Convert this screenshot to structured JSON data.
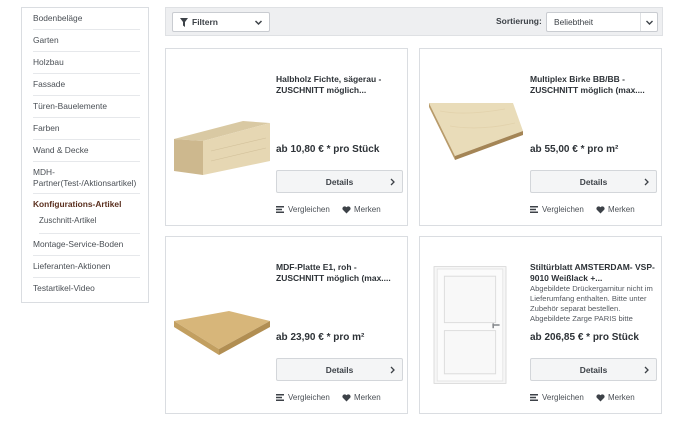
{
  "sidebar": {
    "items": [
      {
        "label": "Bodenbeläge"
      },
      {
        "label": "Garten"
      },
      {
        "label": "Holzbau"
      },
      {
        "label": "Fassade"
      },
      {
        "label": "Türen-Bauelemente"
      },
      {
        "label": "Farben"
      },
      {
        "label": "Wand & Decke"
      },
      {
        "label": "MDH-Partner(Test-/Aktionsartikel)"
      },
      {
        "label": "Konfigurations-Artikel"
      },
      {
        "label": "Zuschnitt-Artikel"
      },
      {
        "label": "Montage-Service-Boden"
      },
      {
        "label": "Lieferanten-Aktionen"
      },
      {
        "label": "Testartikel-Video"
      }
    ]
  },
  "filterbar": {
    "filter_label": "Filtern",
    "sort_label": "Sortierung:",
    "sort_value": "Beliebtheit"
  },
  "products": [
    {
      "title": "Halbholz Fichte, sägerau - ZUSCHNITT möglich...",
      "description": "",
      "price": "ab 10,80 € * pro Stück",
      "details_label": "Details",
      "compare_label": "Vergleichen",
      "note_label": "Merken"
    },
    {
      "title": "Multiplex Birke BB/BB - ZUSCHNITT möglich (max....",
      "description": "",
      "price": "ab 55,00 € * pro m²",
      "details_label": "Details",
      "compare_label": "Vergleichen",
      "note_label": "Merken"
    },
    {
      "title": "MDF-Platte E1, roh - ZUSCHNITT möglich (max....",
      "description": "",
      "price": "ab 23,90 € * pro m²",
      "details_label": "Details",
      "compare_label": "Vergleichen",
      "note_label": "Merken"
    },
    {
      "title": "Stiltürblatt AMSTERDAM- VSP-9010 Weißlack +...",
      "description": "Abgebildete Drückergarnitur nicht im Lieferumfang enthalten. Bitte unter Zubehör separat bestellen. Abgebildete Zarge PARIS bitte",
      "price": "ab 206,85 € * pro Stück",
      "details_label": "Details",
      "compare_label": "Vergleichen",
      "note_label": "Merken"
    }
  ],
  "colors": {
    "active_category": "#5a2f1e",
    "border": "#dadde1",
    "filterbar_bg": "#eeeff1"
  },
  "icons": {
    "filter": "funnel-icon",
    "dropdown": "chevron-down-icon",
    "details_arrow": "chevron-right-icon",
    "compare": "compare-icon",
    "note": "heart-icon"
  }
}
